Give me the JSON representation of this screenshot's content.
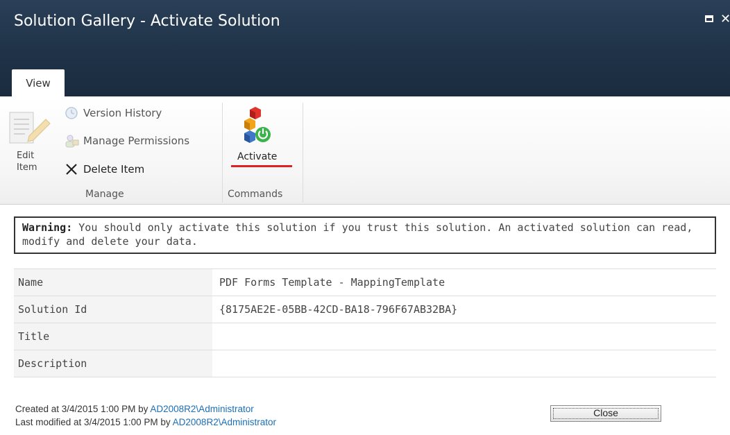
{
  "window": {
    "title": "Solution Gallery - Activate Solution"
  },
  "ribbon": {
    "tabs": [
      {
        "label": "View",
        "active": true
      }
    ],
    "manage": {
      "group_label": "Manage",
      "edit_item_line1": "Edit",
      "edit_item_line2": "Item",
      "version_history": "Version History",
      "manage_permissions": "Manage Permissions",
      "delete_item": "Delete Item"
    },
    "commands": {
      "group_label": "Commands",
      "activate": "Activate"
    }
  },
  "warning": {
    "prefix": "Warning:",
    "text": " You should only activate this solution if you trust this solution. An activated solution can read, modify and delete your data."
  },
  "properties": {
    "rows": [
      {
        "label": "Name",
        "value": "PDF Forms Template - MappingTemplate"
      },
      {
        "label": "Solution Id",
        "value": "{8175AE2E-05BB-42CD-BA18-796F67AB32BA}"
      },
      {
        "label": "Title",
        "value": ""
      },
      {
        "label": "Description",
        "value": ""
      }
    ]
  },
  "footer": {
    "created_prefix": "Created at 3/4/2015 1:00 PM by ",
    "created_by": "AD2008R2\\Administrator",
    "modified_prefix": "Last modified at 3/4/2015 1:00 PM by ",
    "modified_by": "AD2008R2\\Administrator",
    "close_label": "Close"
  },
  "colors": {
    "titlebar": "#1f3247",
    "link": "#1a6fb8",
    "accent_underline": "#e02020"
  }
}
